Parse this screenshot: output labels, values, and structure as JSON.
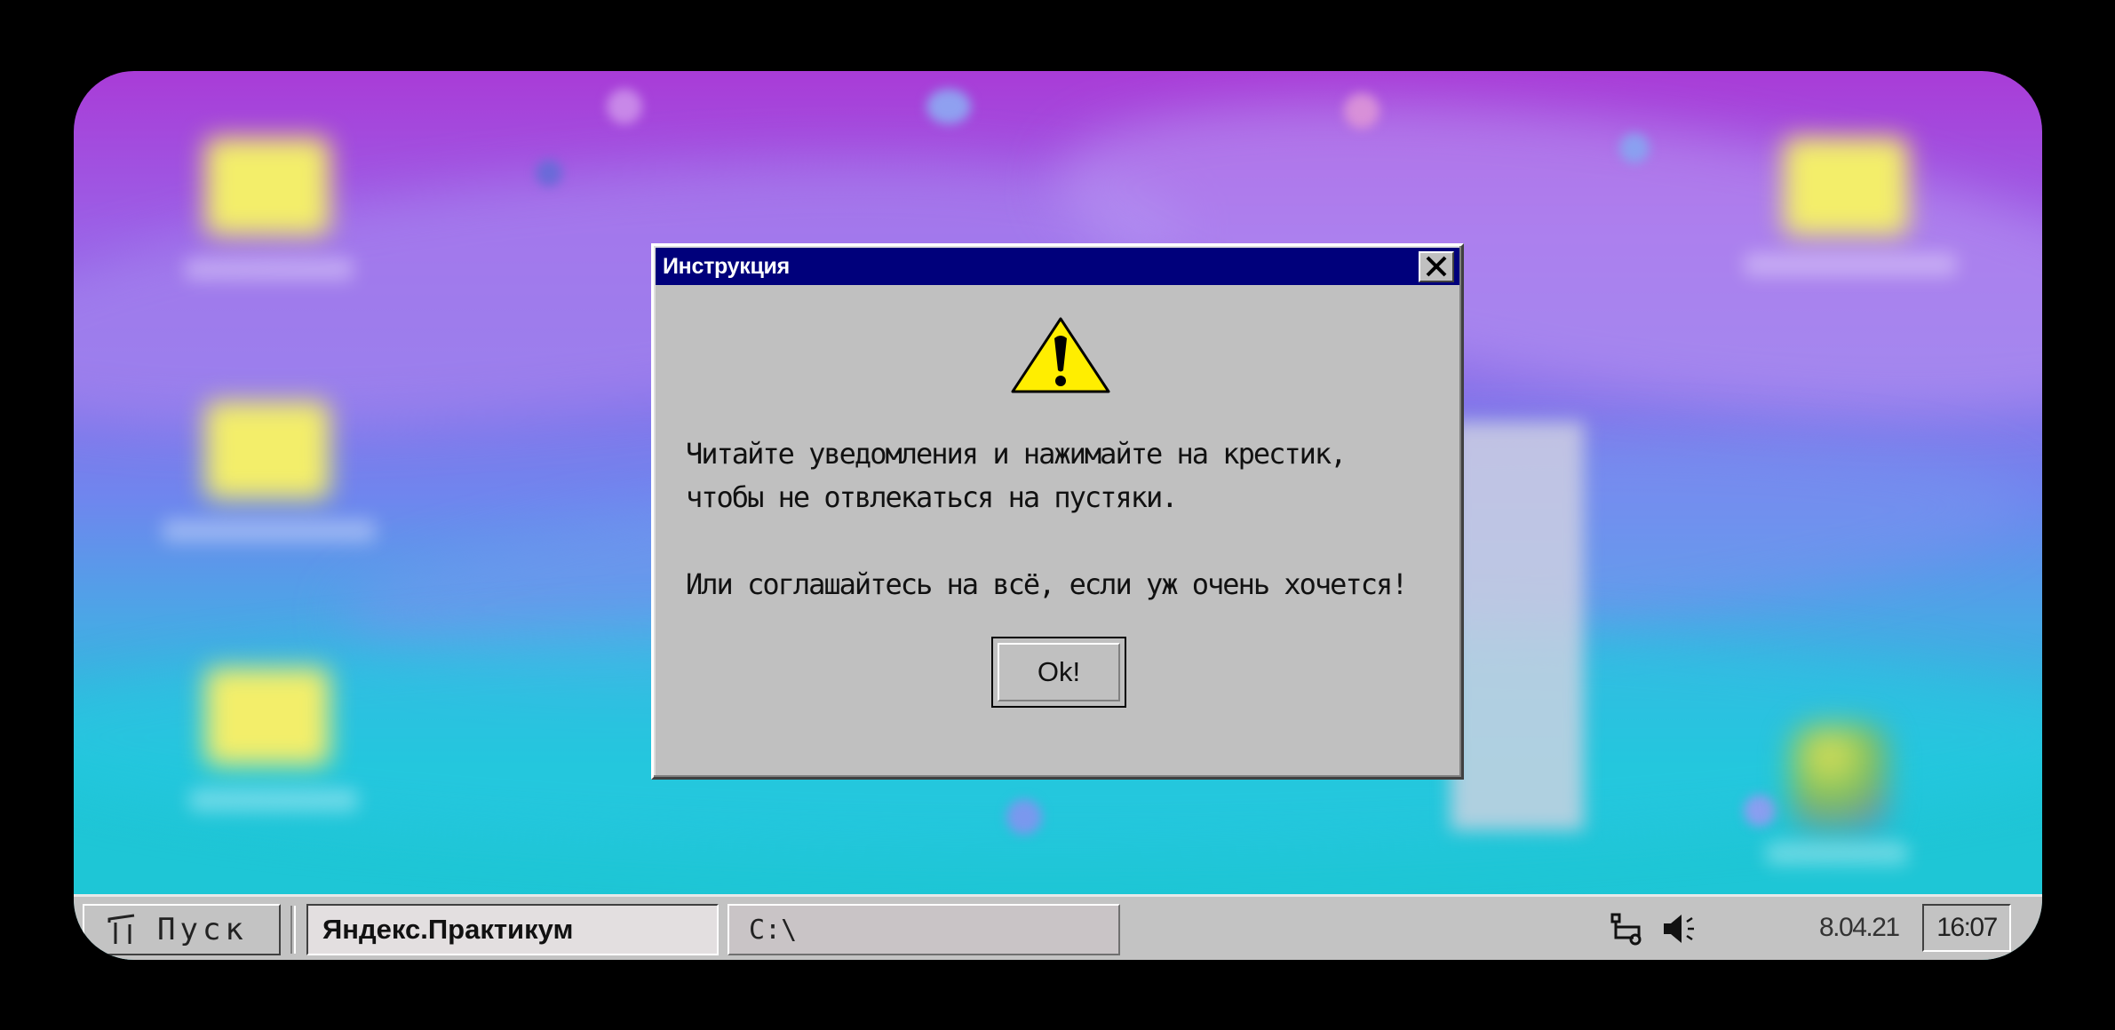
{
  "dialog": {
    "title": "Инструкция",
    "line1": "Читайте уведомления и нажимайте на крестик,",
    "line2": "чтобы не отвлекаться на пустяки.",
    "line3": "Или соглашайтесь на всё, если уж очень хочется!",
    "ok_label": "Ok!"
  },
  "taskbar": {
    "start_label": "Пуск",
    "tasks": [
      {
        "label": "Яндекс.Практикум",
        "active": true
      },
      {
        "label": "C:\\",
        "active": false
      }
    ],
    "date": "8.04.21",
    "time": "16:07"
  },
  "icons": {
    "warning": "warning-icon",
    "close": "close-icon",
    "start": "start-icon",
    "network": "network-icon",
    "volume": "volume-icon"
  },
  "colors": {
    "titlebar": "#00007b",
    "dialog_bg": "#c0c0c0",
    "warning_fill": "#ffee00"
  }
}
